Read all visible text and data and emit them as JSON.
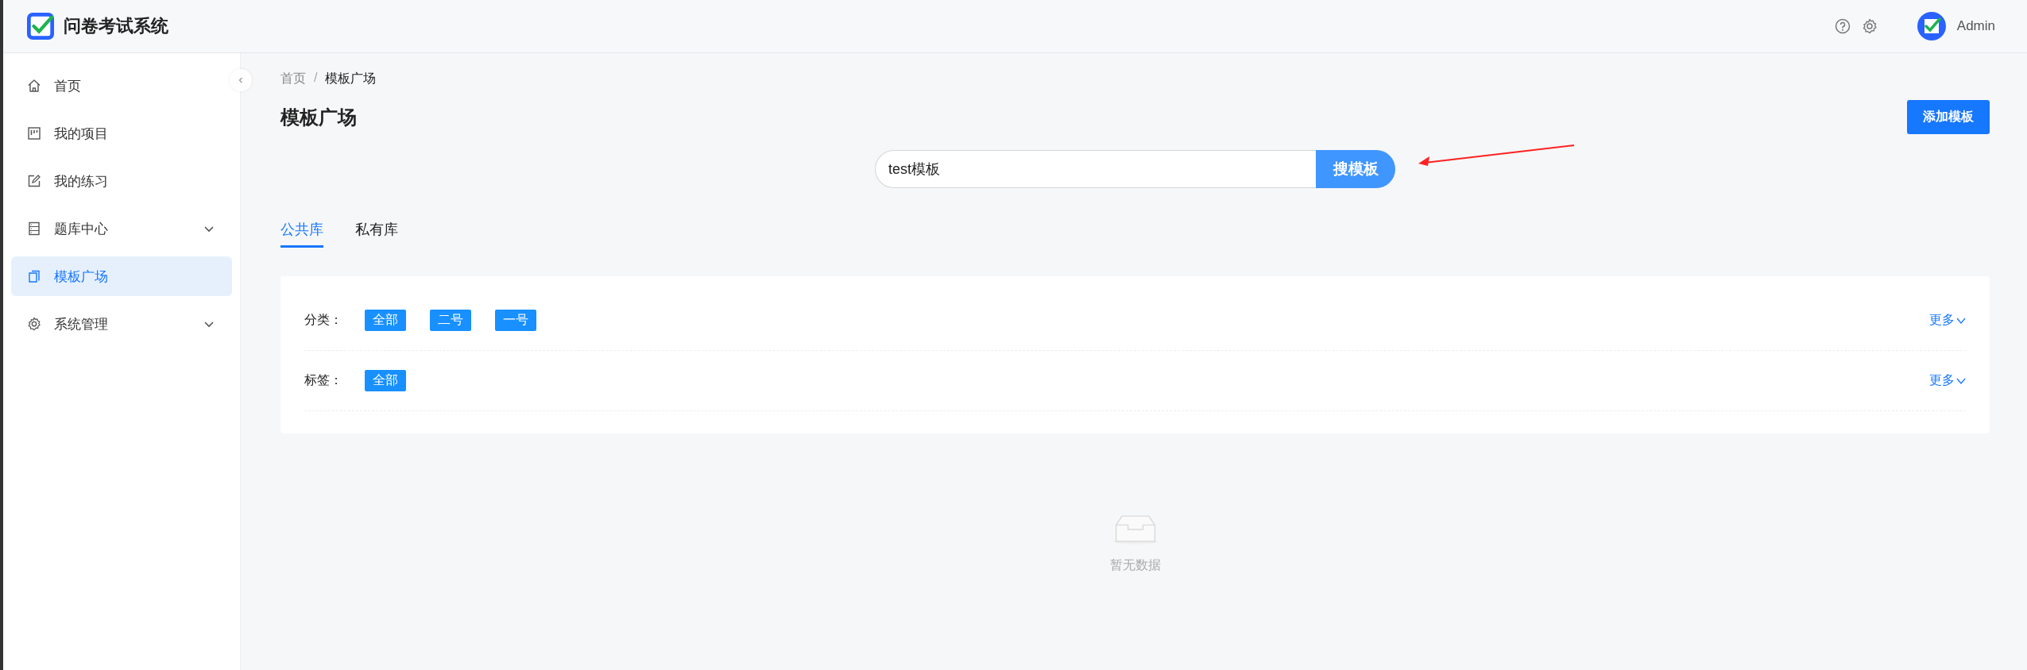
{
  "header": {
    "title": "问卷考试系统",
    "user": "Admin"
  },
  "sidebar": {
    "items": [
      {
        "label": "首页",
        "kind": "home",
        "selected": false,
        "submenu": false
      },
      {
        "label": "我的项目",
        "kind": "board",
        "selected": false,
        "submenu": false
      },
      {
        "label": "我的练习",
        "kind": "edit",
        "selected": false,
        "submenu": false
      },
      {
        "label": "题库中心",
        "kind": "list",
        "selected": false,
        "submenu": true
      },
      {
        "label": "模板广场",
        "kind": "copy",
        "selected": true,
        "submenu": false
      },
      {
        "label": "系统管理",
        "kind": "gear",
        "selected": false,
        "submenu": true
      }
    ]
  },
  "breadcrumb": {
    "separator": "/",
    "items": [
      "首页",
      "模板广场"
    ]
  },
  "page_title": "模板广场",
  "add_button": "添加模板",
  "search": {
    "value": "test模板",
    "button": "搜模板"
  },
  "tabs": [
    {
      "label": "公共库",
      "selected": true
    },
    {
      "label": "私有库",
      "selected": false
    }
  ],
  "filters": [
    {
      "label": "分类：",
      "tags": [
        "全部",
        "二号",
        "一号"
      ],
      "more": "更多"
    },
    {
      "label": "标签：",
      "tags": [
        "全部"
      ],
      "more": "更多"
    }
  ],
  "empty": {
    "text": "暂无数据"
  }
}
